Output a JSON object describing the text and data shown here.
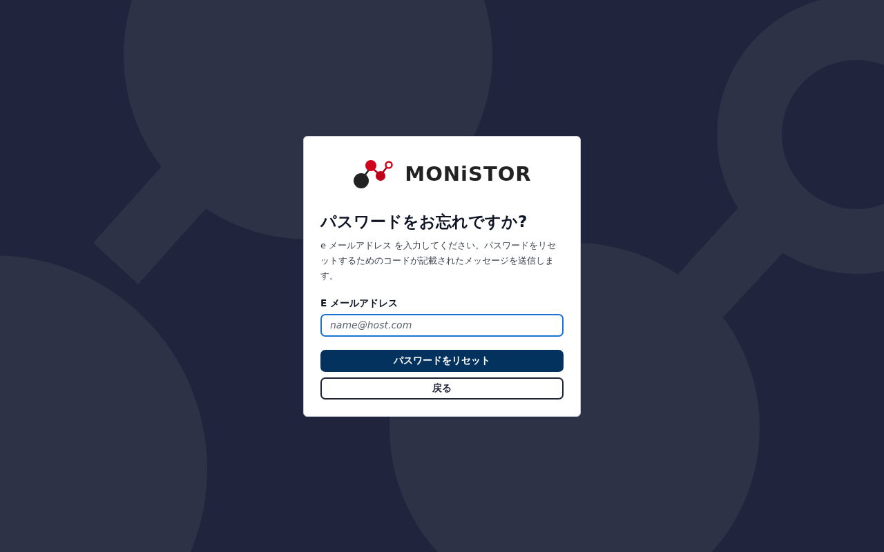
{
  "logo": {
    "text": "MONiSTOR"
  },
  "title": "パスワードをお忘れですか?",
  "description": "e メールアドレス を入力してください。パスワードをリセットするためのコードが記載されたメッセージを送信します。",
  "email_field": {
    "label": "E メールアドレス",
    "placeholder": "name@host.com",
    "focused": true
  },
  "buttons": [
    {
      "label": "パスワードをリセット",
      "kind": "primary"
    },
    {
      "label": "戻る",
      "kind": "secondary"
    }
  ]
}
